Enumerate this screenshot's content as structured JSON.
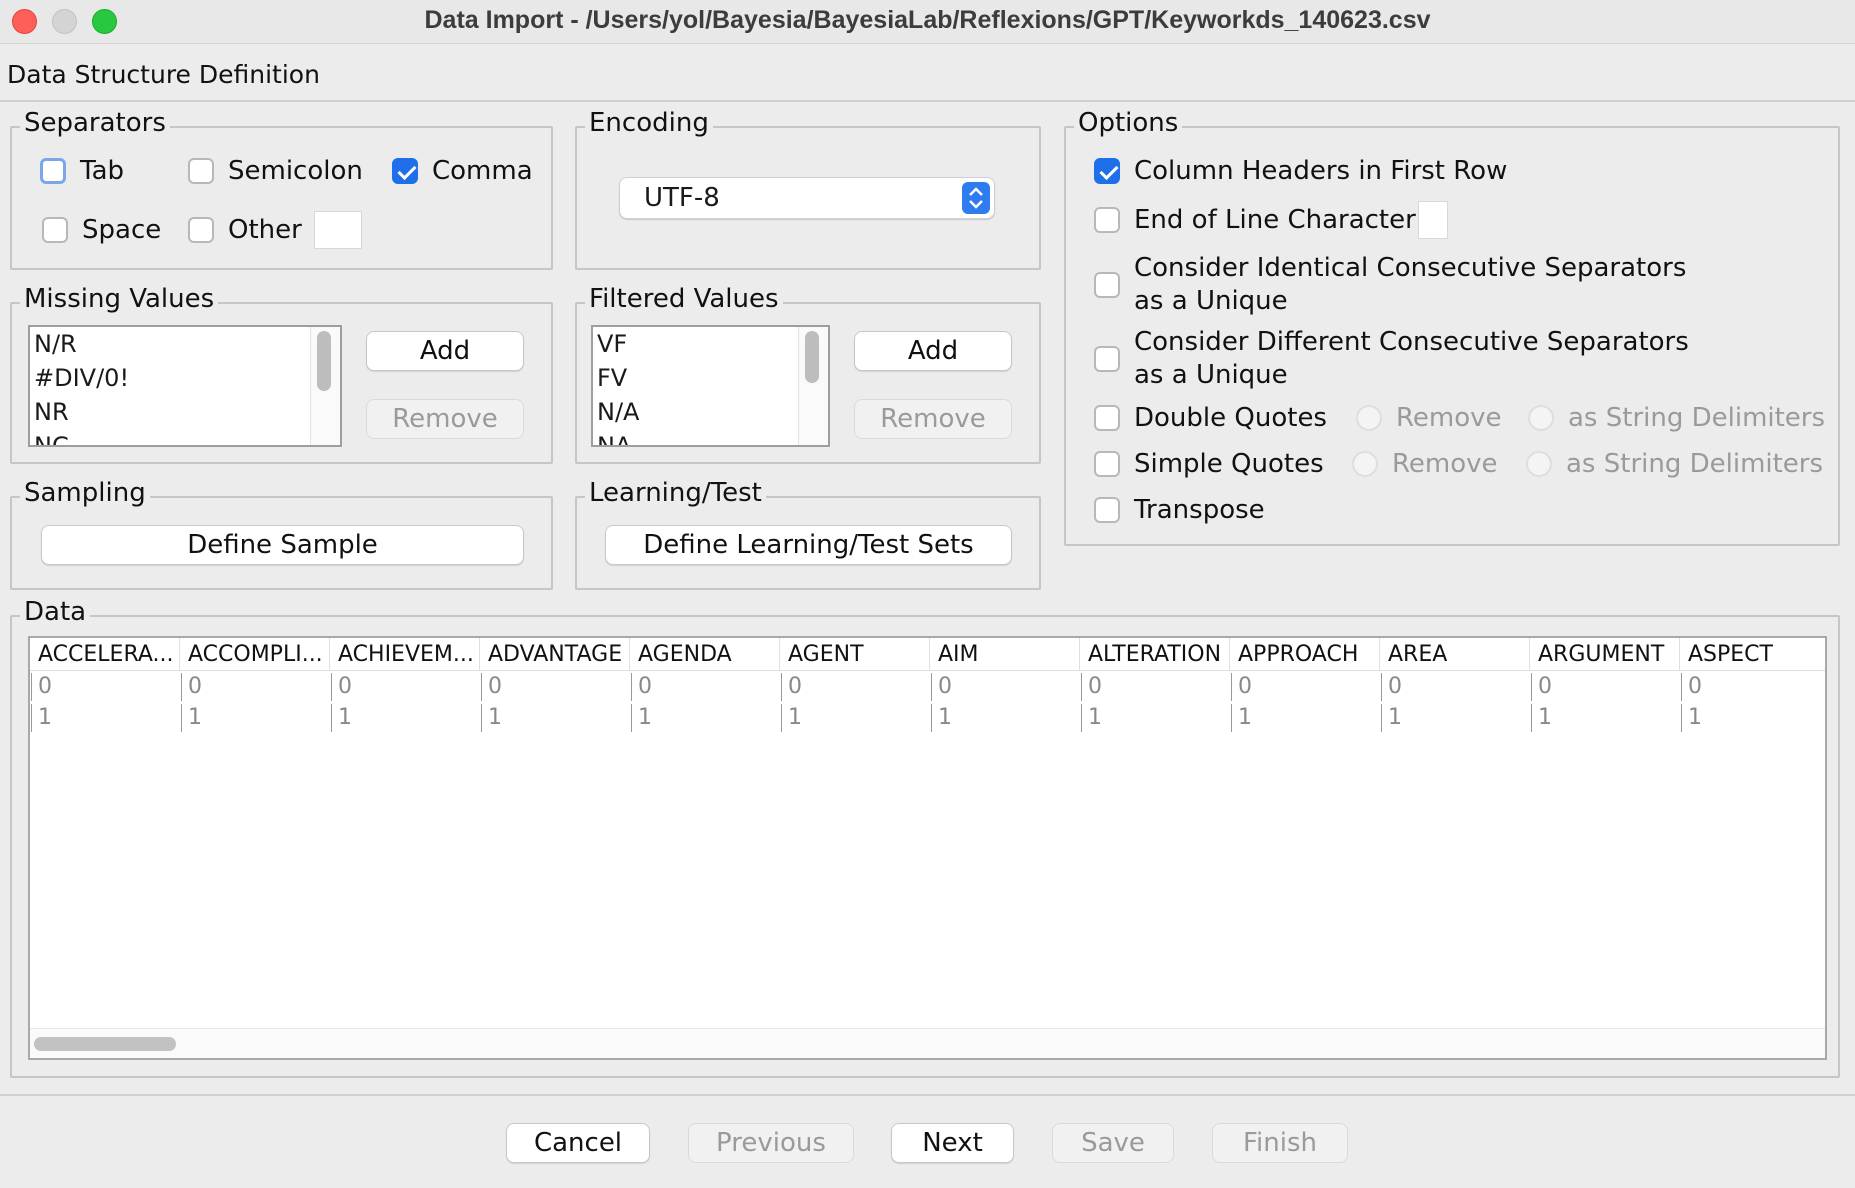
{
  "window": {
    "title": "Data Import - /Users/yol/Bayesia/BayesiaLab/Reflexions/GPT/Keyworkds_140623.csv"
  },
  "header": {
    "label": "Data Structure Definition"
  },
  "separators": {
    "title": "Separators",
    "tab": {
      "label": "Tab",
      "checked": false
    },
    "semicolon": {
      "label": "Semicolon",
      "checked": false
    },
    "comma": {
      "label": "Comma",
      "checked": true
    },
    "space": {
      "label": "Space",
      "checked": false
    },
    "other": {
      "label": "Other",
      "checked": false,
      "value": ""
    }
  },
  "encoding": {
    "title": "Encoding",
    "selected": "UTF-8"
  },
  "options": {
    "title": "Options",
    "column_headers": {
      "label": "Column Headers in First Row",
      "checked": true
    },
    "end_of_line": {
      "label": "End of Line Character",
      "checked": false
    },
    "identical_consecutive": {
      "line1": "Consider Identical Consecutive Separators",
      "line2": "as a Unique",
      "checked": false
    },
    "different_consecutive": {
      "line1": "Consider Different Consecutive Separators",
      "line2": "as a Unique",
      "checked": false
    },
    "double_quotes": {
      "label": "Double Quotes",
      "checked": false,
      "remove": "Remove",
      "delimiters": "as String Delimiters"
    },
    "simple_quotes": {
      "label": "Simple Quotes",
      "checked": false,
      "remove": "Remove",
      "delimiters": "as String Delimiters"
    },
    "transpose": {
      "label": "Transpose",
      "checked": false
    }
  },
  "missing_values": {
    "title": "Missing Values",
    "items": [
      "N/R",
      "#DIV/0!",
      "NR",
      "NC"
    ],
    "add_label": "Add",
    "remove_label": "Remove"
  },
  "filtered_values": {
    "title": "Filtered Values",
    "items": [
      "VF",
      "FV",
      "N/A",
      "NA"
    ],
    "add_label": "Add",
    "remove_label": "Remove"
  },
  "sampling": {
    "title": "Sampling",
    "button_label": "Define Sample"
  },
  "learning_test": {
    "title": "Learning/Test",
    "button_label": "Define Learning/Test Sets"
  },
  "data": {
    "title": "Data",
    "columns": [
      "ACCELERA...",
      "ACCOMPLI...",
      "ACHIEVEM...",
      "ADVANTAGE",
      "AGENDA",
      "AGENT",
      "AIM",
      "ALTERATION",
      "APPROACH",
      "AREA",
      "ARGUMENT",
      "ASPECT"
    ],
    "rows": [
      [
        "0",
        "0",
        "0",
        "0",
        "0",
        "0",
        "0",
        "0",
        "0",
        "0",
        "0",
        "0"
      ],
      [
        "1",
        "1",
        "1",
        "1",
        "1",
        "1",
        "1",
        "1",
        "1",
        "1",
        "1",
        "1"
      ]
    ]
  },
  "footer": {
    "cancel": "Cancel",
    "previous": "Previous",
    "next": "Next",
    "save": "Save",
    "finish": "Finish"
  },
  "colors": {
    "accent": "#1f6feb",
    "close": "#fe5f57",
    "maximize": "#28c840"
  }
}
